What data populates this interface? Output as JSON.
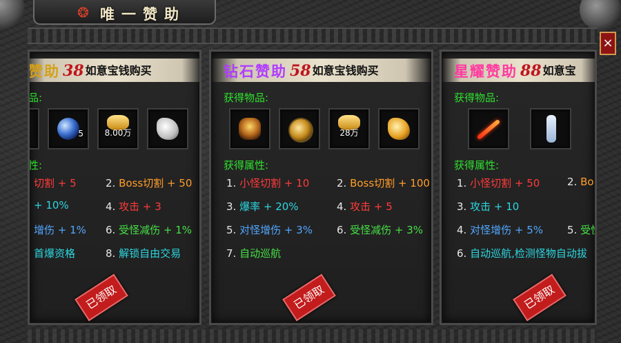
{
  "window": {
    "title": "唯一赞助",
    "close_label": "×"
  },
  "cards": [
    {
      "name_prefix": "",
      "name_suffix": "赞助",
      "price": "38",
      "price_tail": "如意宝钱购买",
      "items_label": "品:",
      "items": [
        {
          "icon": "gem-orb-icon",
          "count": "5"
        },
        {
          "icon": "gold-ingot-icon",
          "count": "8.00万"
        },
        {
          "icon": "white-horse-mount-icon",
          "count": ""
        }
      ],
      "attr_label": "性:",
      "attrs": [
        {
          "no": "",
          "text": "切割 + 5",
          "color": "#ff3b3b"
        },
        {
          "no": "2.",
          "text": "Boss切割 + 50",
          "color": "#ff9d2a"
        },
        {
          "no": "",
          "text": "+ 10%",
          "color": "#2dd6e0"
        },
        {
          "no": "4.",
          "text": "攻击 + 3",
          "color": "#ff3b3b"
        },
        {
          "no": "",
          "text": "增伤 + 1%",
          "color": "#52a7ff"
        },
        {
          "no": "6.",
          "text": "受怪减伤 + 1%",
          "color": "#46e046"
        },
        {
          "no": "",
          "text": "首爆资格",
          "color": "#2dd6e0"
        },
        {
          "no": "8.",
          "text": "解锁自由交易",
          "color": "#2dd6e0"
        }
      ],
      "stamp": "已领取"
    },
    {
      "name_prefix": "钻石",
      "name_suffix": "赞助",
      "price": "58",
      "price_tail": "如意宝钱购买",
      "items_label": "获得物品:",
      "items": [
        {
          "icon": "golden-helmet-icon",
          "count": ""
        },
        {
          "icon": "gold-coin-medallion-icon",
          "count": ""
        },
        {
          "icon": "gold-ingot-icon",
          "count": "28万"
        },
        {
          "icon": "golden-horse-mount-icon",
          "count": ""
        }
      ],
      "attr_label": "获得属性:",
      "attrs": [
        {
          "no": "1.",
          "text": "小怪切割 + 10",
          "color": "#ff3b3b"
        },
        {
          "no": "2.",
          "text": "Boss切割 + 100",
          "color": "#ff9d2a"
        },
        {
          "no": "3.",
          "text": "爆率 + 20%",
          "color": "#2dd6e0"
        },
        {
          "no": "4.",
          "text": "攻击 + 5",
          "color": "#ff3b3b"
        },
        {
          "no": "5.",
          "text": "对怪增伤 + 3%",
          "color": "#52a7ff"
        },
        {
          "no": "6.",
          "text": "受怪减伤 + 3%",
          "color": "#46e046"
        },
        {
          "no": "7.",
          "text": "自动巡航",
          "color": "#46e046"
        }
      ],
      "stamp": "已领取"
    },
    {
      "name_prefix": "星耀",
      "name_suffix": "赞助",
      "price": "88",
      "price_tail": "如意宝",
      "items_label": "获得物品:",
      "items": [
        {
          "icon": "flame-sword-icon",
          "count": ""
        },
        {
          "icon": "white-robed-figure-icon",
          "count": ""
        }
      ],
      "attr_label": "获得属性:",
      "attrs": [
        {
          "no": "1.",
          "text": "小怪切割 + 50",
          "color": "#ff3b3b"
        },
        {
          "no": "2.",
          "text": "Bo",
          "color": "#ff9d2a"
        },
        {
          "no": "3.",
          "text": "攻击 + 10",
          "color": "#2dd6e0"
        },
        {
          "no": "",
          "text": "",
          "color": "#ff3b3b"
        },
        {
          "no": "4.",
          "text": "对怪增伤 + 5%",
          "color": "#52a7ff"
        },
        {
          "no": "5.",
          "text": "受怪",
          "color": "#46e046"
        },
        {
          "no": "6.",
          "text": "自动巡航,检测怪物自动拔",
          "color": "#2dd6e0"
        }
      ],
      "stamp": "已领取"
    }
  ],
  "colors": {
    "header_name_1": "#d4a018",
    "header_name_2": "#b03cff",
    "header_name_3": "#ff3aa0",
    "price": "#c0141d",
    "section_label": "#2ee02e"
  }
}
